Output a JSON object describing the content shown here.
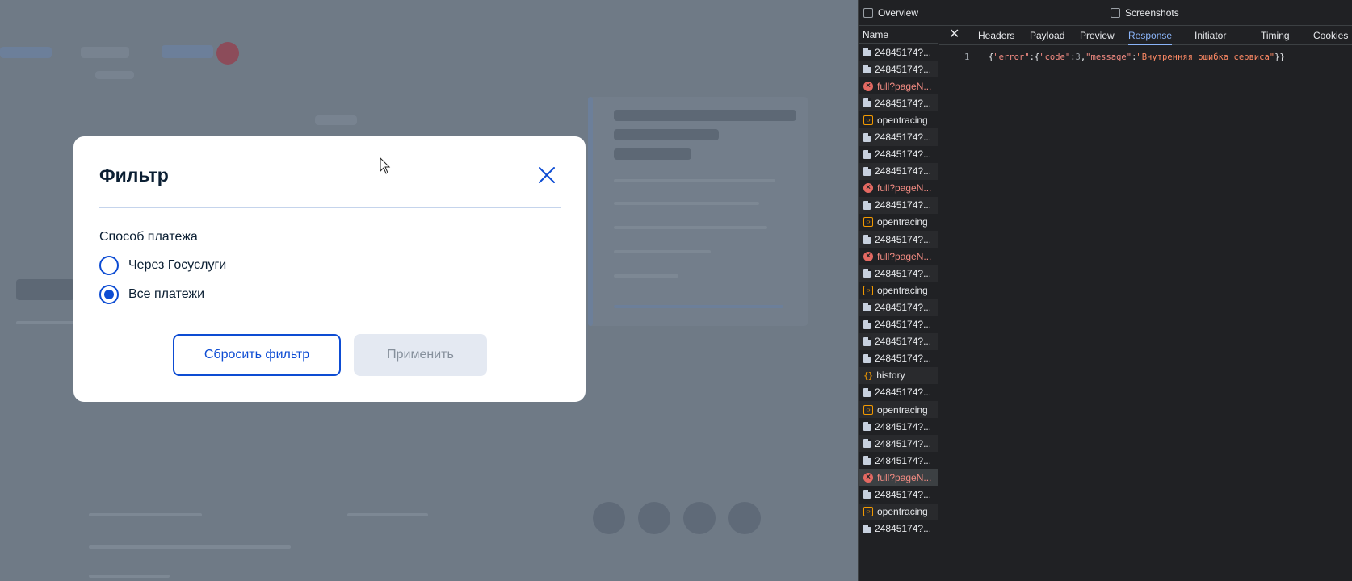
{
  "modal": {
    "title": "Фильтр",
    "group_label": "Способ платежа",
    "options": [
      {
        "label": "Через Госуслуги",
        "checked": false
      },
      {
        "label": "Все платежи",
        "checked": true
      }
    ],
    "reset_label": "Сбросить фильтр",
    "apply_label": "Применить"
  },
  "devtools": {
    "overview_label": "Overview",
    "screenshots_label": "Screenshots",
    "name_header": "Name",
    "close_glyph": "✕",
    "tabs": [
      "Headers",
      "Payload",
      "Preview",
      "Response",
      "Initiator",
      "Timing",
      "Cookies"
    ],
    "active_tab": "Response",
    "requests": [
      {
        "name": "24845174?...",
        "type": "doc"
      },
      {
        "name": "24845174?...",
        "type": "doc"
      },
      {
        "name": "full?pageN...",
        "type": "error"
      },
      {
        "name": "24845174?...",
        "type": "doc"
      },
      {
        "name": "opentracing",
        "type": "script"
      },
      {
        "name": "24845174?...",
        "type": "doc"
      },
      {
        "name": "24845174?...",
        "type": "doc"
      },
      {
        "name": "24845174?...",
        "type": "doc"
      },
      {
        "name": "full?pageN...",
        "type": "error"
      },
      {
        "name": "24845174?...",
        "type": "doc"
      },
      {
        "name": "opentracing",
        "type": "script"
      },
      {
        "name": "24845174?...",
        "type": "doc"
      },
      {
        "name": "full?pageN...",
        "type": "error"
      },
      {
        "name": "24845174?...",
        "type": "doc"
      },
      {
        "name": "opentracing",
        "type": "script"
      },
      {
        "name": "24845174?...",
        "type": "doc"
      },
      {
        "name": "24845174?...",
        "type": "doc"
      },
      {
        "name": "24845174?...",
        "type": "doc"
      },
      {
        "name": "24845174?...",
        "type": "doc"
      },
      {
        "name": "history",
        "type": "fetch"
      },
      {
        "name": "24845174?...",
        "type": "doc"
      },
      {
        "name": "opentracing",
        "type": "script"
      },
      {
        "name": "24845174?...",
        "type": "doc"
      },
      {
        "name": "24845174?...",
        "type": "doc"
      },
      {
        "name": "24845174?...",
        "type": "doc"
      },
      {
        "name": "full?pageN...",
        "type": "error",
        "selected": true
      },
      {
        "name": "24845174?...",
        "type": "doc"
      },
      {
        "name": "opentracing",
        "type": "script"
      },
      {
        "name": "24845174?...",
        "type": "doc"
      }
    ],
    "response": {
      "line_number": "1",
      "tokens": [
        {
          "t": "{",
          "c": "punct"
        },
        {
          "t": "\"error\"",
          "c": "key"
        },
        {
          "t": ":{",
          "c": "punct"
        },
        {
          "t": "\"code\"",
          "c": "key"
        },
        {
          "t": ":",
          "c": "punct"
        },
        {
          "t": "3",
          "c": "num"
        },
        {
          "t": ",",
          "c": "punct"
        },
        {
          "t": "\"message\"",
          "c": "key"
        },
        {
          "t": ":",
          "c": "punct"
        },
        {
          "t": "\"Внутренняя ошибка сервиса\"",
          "c": "str"
        },
        {
          "t": "}}",
          "c": "punct"
        }
      ]
    }
  }
}
